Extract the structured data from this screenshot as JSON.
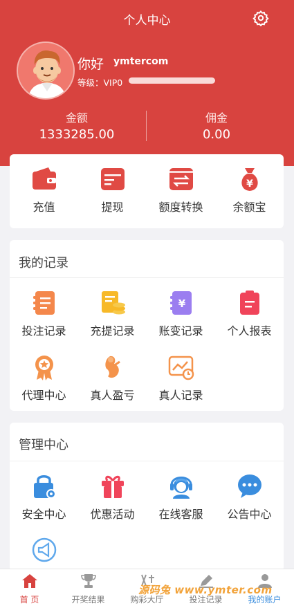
{
  "header": {
    "title": "个人中心",
    "greeting": "你好",
    "username": "ymtercom",
    "level_label": "等级：VIP0",
    "balance_label": "金额",
    "balance_value": "1333285.00",
    "commission_label": "佣金",
    "commission_value": "0.00"
  },
  "quick_actions": [
    {
      "label": "充值",
      "icon": "wallet-icon"
    },
    {
      "label": "提现",
      "icon": "card-icon"
    },
    {
      "label": "额度转换",
      "icon": "transfer-icon"
    },
    {
      "label": "余额宝",
      "icon": "money-bag-icon"
    }
  ],
  "records": {
    "title": "我的记录",
    "items": [
      {
        "label": "投注记录",
        "icon": "bet-record-icon",
        "color": "#f4874b"
      },
      {
        "label": "充提记录",
        "icon": "deposit-record-icon",
        "color": "#f7b928"
      },
      {
        "label": "账变记录",
        "icon": "ledger-icon",
        "color": "#9b7ef0"
      },
      {
        "label": "个人报表",
        "icon": "report-icon",
        "color": "#f0445a"
      },
      {
        "label": "代理中心",
        "icon": "medal-icon",
        "color": "#f4934b"
      },
      {
        "label": "真人盈亏",
        "icon": "live-profit-icon",
        "color": "#f4934b"
      },
      {
        "label": "真人记录",
        "icon": "live-record-icon",
        "color": "#f4934b"
      }
    ]
  },
  "management": {
    "title": "管理中心",
    "items": [
      {
        "label": "安全中心",
        "icon": "lock-icon",
        "color": "#3a8dde"
      },
      {
        "label": "优惠活动",
        "icon": "gift-icon",
        "color": "#f0445a"
      },
      {
        "label": "在线客服",
        "icon": "support-icon",
        "color": "#3a8dde"
      },
      {
        "label": "公告中心",
        "icon": "chat-icon",
        "color": "#3a8dde"
      },
      {
        "label": "",
        "icon": "megaphone-icon",
        "color": "#3a8dde"
      }
    ]
  },
  "tabs": [
    {
      "label": "首 页",
      "icon": "home-icon"
    },
    {
      "label": "开奖结果",
      "icon": "trophy-icon"
    },
    {
      "label": "购彩大厅",
      "icon": "lottery-icon"
    },
    {
      "label": "投注记录",
      "icon": "pencil-icon"
    },
    {
      "label": "我的账户",
      "icon": "user-icon"
    }
  ],
  "watermark": "源码兔 www.ymter.com",
  "colors": {
    "brand": "#d8433f",
    "accent_blue": "#3a8dde"
  }
}
